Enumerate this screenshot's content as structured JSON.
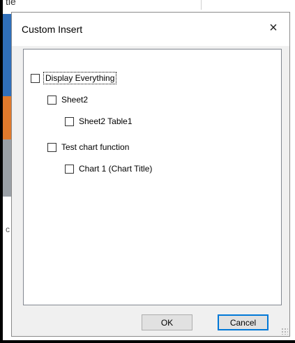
{
  "background": {
    "title_fragment": "tle",
    "tick_fragment": "c"
  },
  "dialog": {
    "title": "Custom Insert",
    "close_icon": "×",
    "tree": [
      {
        "label": "Display Everything",
        "checked": false,
        "level": 0,
        "focused": true
      },
      {
        "label": "Sheet2",
        "checked": false,
        "level": 1
      },
      {
        "label": "Sheet2 Table1",
        "checked": false,
        "level": 2
      },
      {
        "label": "Test chart function",
        "checked": false,
        "level": 1
      },
      {
        "label": "Chart 1 (Chart Title)",
        "checked": false,
        "level": 2
      }
    ],
    "ok_label": "OK",
    "cancel_label": "Cancel"
  },
  "colors": {
    "accent": "#0078d7",
    "dialog_bg": "#f0f0f0",
    "button_bg": "#e1e1e1"
  }
}
